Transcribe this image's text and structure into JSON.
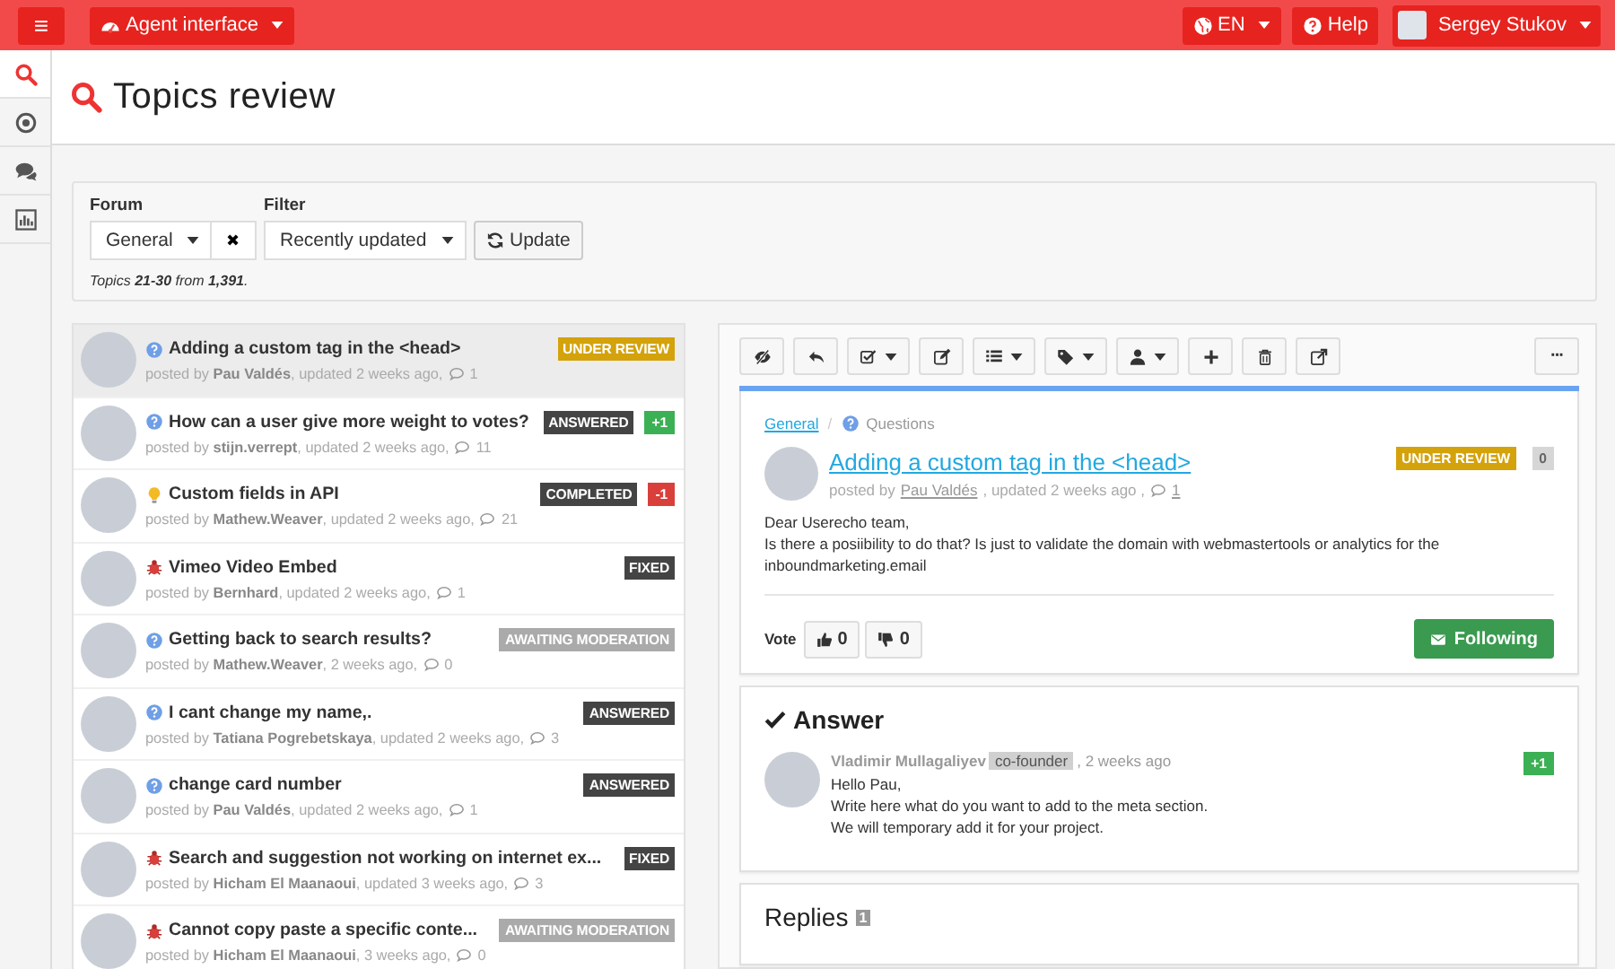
{
  "topbar": {
    "menu_label": "≡",
    "app_menu": "Agent interface",
    "language": "EN",
    "help": "Help",
    "user": "Sergey Stukov"
  },
  "sidebar": {
    "items": [
      {
        "kind": "search",
        "selected": true
      },
      {
        "kind": "target",
        "selected": false
      },
      {
        "kind": "chat",
        "selected": false
      },
      {
        "kind": "chart",
        "selected": false
      }
    ]
  },
  "page": {
    "title": "Topics review"
  },
  "filters": {
    "forum_label": "Forum",
    "forum_value": "General",
    "clear": "✖",
    "filter_label": "Filter",
    "filter_value": "Recently updated",
    "update": "Update",
    "summary": "Topics **21-30** from **1,391**."
  },
  "topics": [
    {
      "kind": "question",
      "title": "Adding a custom tag in the <head>",
      "meta": "posted by **Pau Valdés**, updated 2 weeks ago,",
      "comments": "1",
      "status": {
        "label": "UNDER REVIEW",
        "color": "#d4a20a"
      },
      "selected": true
    },
    {
      "kind": "question",
      "title": "How can a user give more weight to votes?",
      "meta": "posted by **stijn.verrept**, updated 2 weeks ago,",
      "comments": "11",
      "status": {
        "label": "ANSWERED",
        "color": "#444444"
      },
      "vote": {
        "label": "+1",
        "color": "#3cb054"
      },
      "selected": false
    },
    {
      "kind": "idea",
      "title": "Custom fields in API",
      "meta": "posted by **Mathew.Weaver**, updated 2 weeks ago,",
      "comments": "21",
      "status": {
        "label": "COMPLETED",
        "color": "#444444"
      },
      "vote": {
        "label": "-1",
        "color": "#d9403c"
      },
      "selected": false
    },
    {
      "kind": "bug",
      "title": "Vimeo Video Embed",
      "meta": "posted by **Bernhard**, updated 2 weeks ago,",
      "comments": "1",
      "status": {
        "label": "FIXED",
        "color": "#444444"
      },
      "selected": false
    },
    {
      "kind": "question",
      "title": "Getting back to search results?",
      "meta": "posted by **Mathew.Weaver**, 2 weeks ago,",
      "comments": "0",
      "status": {
        "label": "AWAITING MODERATION",
        "color": "#aaaaaa"
      },
      "selected": false
    },
    {
      "kind": "question",
      "title": "I cant change my name,.",
      "meta": "posted by **Tatiana Pogrebetskaya**, updated 2 weeks ago,",
      "comments": "3",
      "status": {
        "label": "ANSWERED",
        "color": "#444444"
      },
      "selected": false
    },
    {
      "kind": "question",
      "title": "change card number",
      "meta": "posted by **Pau Valdés**, updated 2 weeks ago,",
      "comments": "1",
      "status": {
        "label": "ANSWERED",
        "color": "#444444"
      },
      "selected": false
    },
    {
      "kind": "bug",
      "title": "Search and suggestion not working on internet ex...",
      "meta": "posted by **Hicham El Maanaoui**, updated 3 weeks ago,",
      "comments": "3",
      "status": {
        "label": "FIXED",
        "color": "#444444"
      },
      "selected": false
    },
    {
      "kind": "bug",
      "title": "Cannot copy paste a specific conte...",
      "meta": "posted by **Hicham El Maanaoui**, 3 weeks ago,",
      "comments": "0",
      "status": {
        "label": "AWAITING MODERATION",
        "color": "#aaaaaa"
      },
      "selected": false
    }
  ],
  "toolbar": [
    {
      "kind": "hide",
      "caret": false
    },
    {
      "kind": "reply",
      "caret": false
    },
    {
      "kind": "check",
      "caret": true
    },
    {
      "kind": "edit",
      "caret": false
    },
    {
      "kind": "list",
      "caret": true
    },
    {
      "kind": "tag",
      "caret": true
    },
    {
      "kind": "user",
      "caret": true
    },
    {
      "kind": "plus",
      "caret": false
    },
    {
      "kind": "trash",
      "caret": false
    },
    {
      "kind": "external",
      "caret": false
    }
  ],
  "more": "···",
  "topic": {
    "forum": "General",
    "separator": "/",
    "category": "Questions",
    "title": "Adding a custom tag in the <head>",
    "posted_by": "posted by",
    "author": "Pau Valdés",
    "updated": ", updated 2 weeks ago ,",
    "comments": "1",
    "status": {
      "label": "UNDER REVIEW",
      "color": "#d4a20a"
    },
    "votes": "0",
    "body": [
      "Dear Userecho team,",
      "Is there a posiibility to do that? Is just to validate the domain with webmastertools or analytics for the inboundmarketing.email"
    ],
    "vote_label": "Vote",
    "up": "0",
    "down": "0",
    "following": "Following"
  },
  "answer": {
    "heading": "Answer",
    "author": "Vladimir Mullagaliyev",
    "role": "co-founder",
    "when": ", 2 weeks ago",
    "votes": "+1",
    "body": [
      "Hello Pau,",
      "Write here what do you want to add to the meta section.",
      "We will temporary add it for your project."
    ]
  },
  "replies": {
    "heading": "Replies",
    "count": "1"
  }
}
